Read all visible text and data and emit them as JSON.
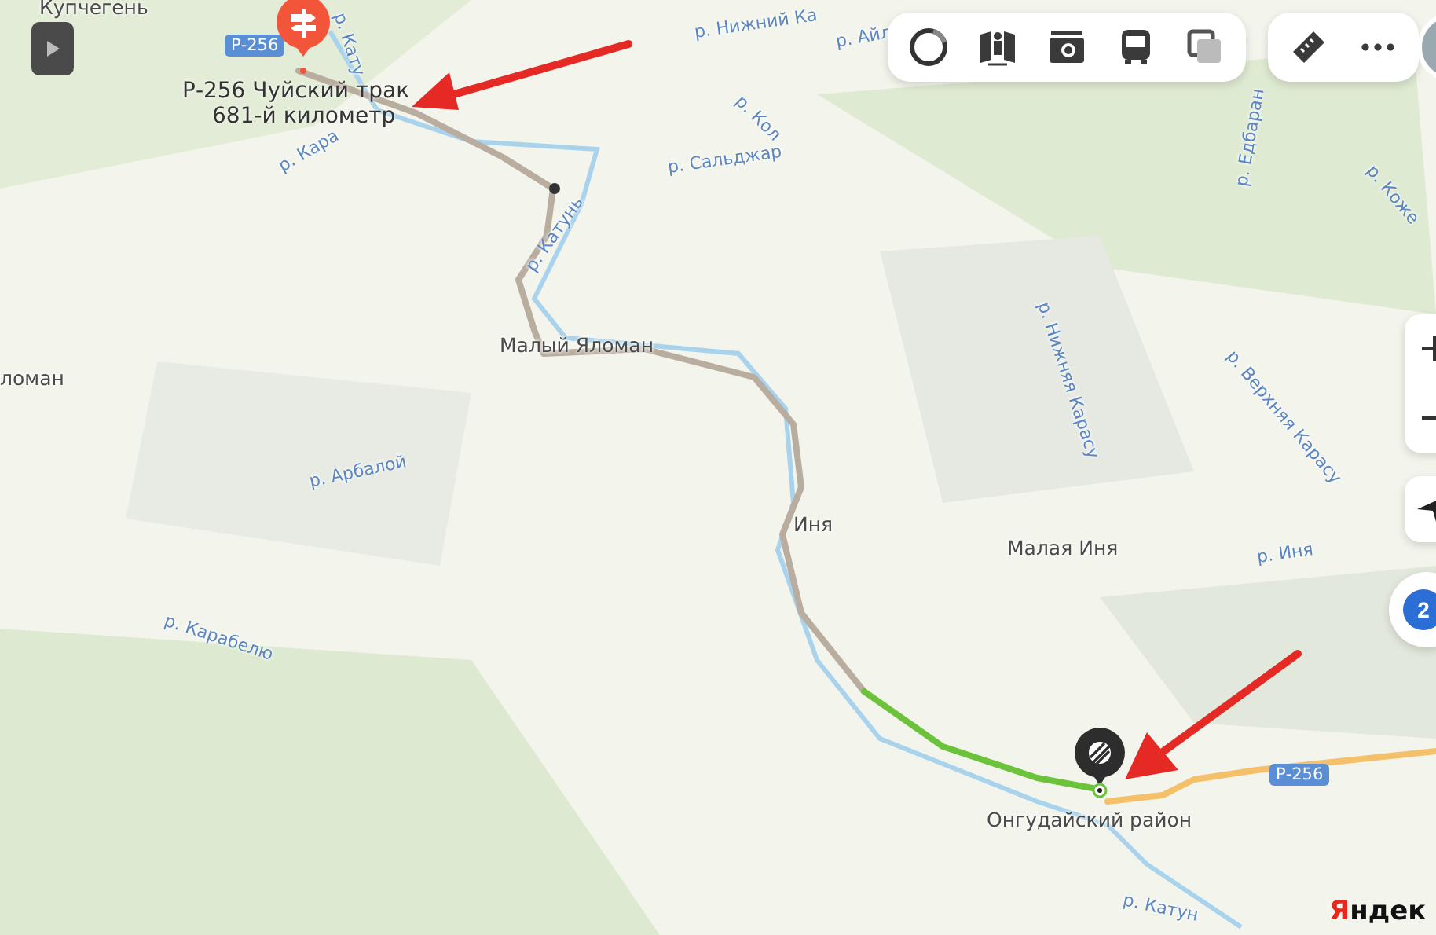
{
  "map": {
    "labels": [
      {
        "text": "Купчегень",
        "kind": "place"
      },
      {
        "text": "Р-256",
        "kind": "shield"
      },
      {
        "text": "р. Кату",
        "kind": "river"
      },
      {
        "text": "р. Кара",
        "kind": "river"
      },
      {
        "text": "р. Нижний Ка",
        "kind": "river"
      },
      {
        "text": "р. Кол",
        "kind": "river"
      },
      {
        "text": "р. Айл",
        "kind": "river"
      },
      {
        "text": "р. Сальджар",
        "kind": "river"
      },
      {
        "text": "р. Катунь",
        "kind": "river"
      },
      {
        "text": "р. Едбаран",
        "kind": "river"
      },
      {
        "text": "р. Коже",
        "kind": "river"
      },
      {
        "text": "Малый Яломан",
        "kind": "place"
      },
      {
        "text": "ломан",
        "kind": "place"
      },
      {
        "text": "р. Нижняя Карасу",
        "kind": "river"
      },
      {
        "text": "р. Верхняя Карасу",
        "kind": "river"
      },
      {
        "text": "р. Арбалой",
        "kind": "river"
      },
      {
        "text": "Иня",
        "kind": "place"
      },
      {
        "text": "Малая Иня",
        "kind": "place"
      },
      {
        "text": "р. Иня",
        "kind": "river"
      },
      {
        "text": "р. Карабелю",
        "kind": "river"
      },
      {
        "text": "Р-256",
        "kind": "shield"
      },
      {
        "text": "Онгудайский район",
        "kind": "place"
      },
      {
        "text": "р. Катун",
        "kind": "river"
      }
    ],
    "pin_caption": [
      "Р-256 Чуйский трак",
      "681-й километр"
    ],
    "traffic_badge": "2",
    "logo": "Яндек"
  }
}
